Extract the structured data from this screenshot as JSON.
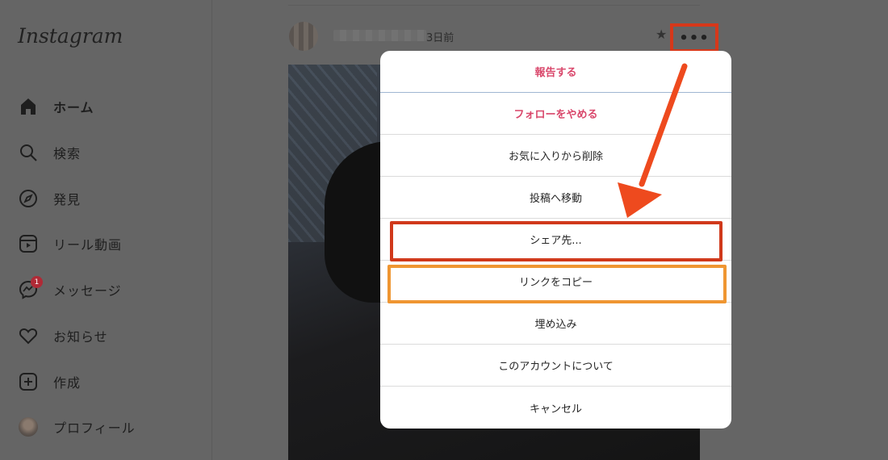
{
  "app": {
    "logo": "Instagram"
  },
  "sidebar": {
    "items": [
      {
        "label": "ホーム",
        "icon": "home-icon"
      },
      {
        "label": "検索",
        "icon": "search-icon"
      },
      {
        "label": "発見",
        "icon": "compass-icon"
      },
      {
        "label": "リール動画",
        "icon": "reels-icon"
      },
      {
        "label": "メッセージ",
        "icon": "messenger-icon",
        "badge": "1"
      },
      {
        "label": "お知らせ",
        "icon": "heart-icon"
      },
      {
        "label": "作成",
        "icon": "plus-square-icon"
      },
      {
        "label": "プロフィール",
        "icon": "profile-avatar"
      }
    ]
  },
  "post": {
    "time": "3日前",
    "more_label": "•••"
  },
  "menu": {
    "items": [
      {
        "label": "報告する",
        "style": "danger"
      },
      {
        "label": "フォローをやめる",
        "style": "danger"
      },
      {
        "label": "お気に入りから削除",
        "style": "normal"
      },
      {
        "label": "投稿へ移動",
        "style": "normal"
      },
      {
        "label": "シェア先...",
        "style": "normal"
      },
      {
        "label": "リンクをコピー",
        "style": "normal"
      },
      {
        "label": "埋め込み",
        "style": "normal"
      },
      {
        "label": "このアカウントについて",
        "style": "normal"
      },
      {
        "label": "キャンセル",
        "style": "normal"
      }
    ]
  },
  "colors": {
    "overlay": "#656565",
    "danger_text": "#d9476b",
    "highlight_red": "#d0391b",
    "highlight_orange": "#ef9632",
    "arrow": "#ee4a1e"
  }
}
